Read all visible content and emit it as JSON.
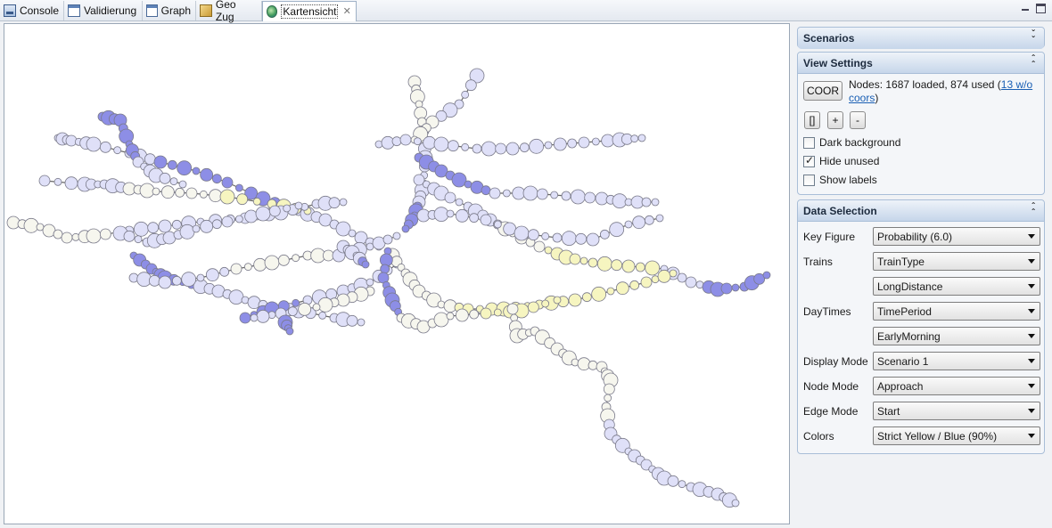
{
  "tabs": [
    {
      "label": "Console",
      "icon": "console-icon"
    },
    {
      "label": "Validierung",
      "icon": "window-icon"
    },
    {
      "label": "Graph",
      "icon": "window-icon"
    },
    {
      "label": "Geo Zug",
      "icon": "geo-icon"
    },
    {
      "label": "Kartensicht",
      "icon": "globe-icon",
      "active": true,
      "close": "✕"
    }
  ],
  "scenarios": {
    "title": "Scenarios"
  },
  "view_settings": {
    "title": "View Settings",
    "coor_button": "COOR",
    "nodes_text": "Nodes: 1687 loaded, 874 used (",
    "nodes_link": "13 w/o coors",
    "nodes_close": ")",
    "fit_button": "[]",
    "zoom_in": "+",
    "zoom_out": "-",
    "dark_background": {
      "label": "Dark background",
      "checked": false
    },
    "hide_unused": {
      "label": "Hide unused",
      "checked": true
    },
    "show_labels": {
      "label": "Show labels",
      "checked": false
    }
  },
  "data_selection": {
    "title": "Data Selection",
    "rows": [
      {
        "label": "Key Figure",
        "value": "Probability (6.0)"
      },
      {
        "label": "Trains",
        "value": "TrainType"
      },
      {
        "label": "",
        "value": "LongDistance"
      },
      {
        "label": "DayTimes",
        "value": "TimePeriod"
      },
      {
        "label": "",
        "value": "EarlyMorning"
      },
      {
        "label": "Display Mode",
        "value": "Scenario 1"
      },
      {
        "label": "Node Mode",
        "value": "Approach"
      },
      {
        "label": "Edge Mode",
        "value": "Start"
      },
      {
        "label": "Colors",
        "value": "Strict Yellow / Blue (90%)"
      }
    ]
  },
  "colors": {
    "blue_strong": "#8d8ee6",
    "blue_light": "#dfe0f8",
    "yellow": "#f6f5c0",
    "pale": "#f6f6ee",
    "edge": "#666666"
  }
}
